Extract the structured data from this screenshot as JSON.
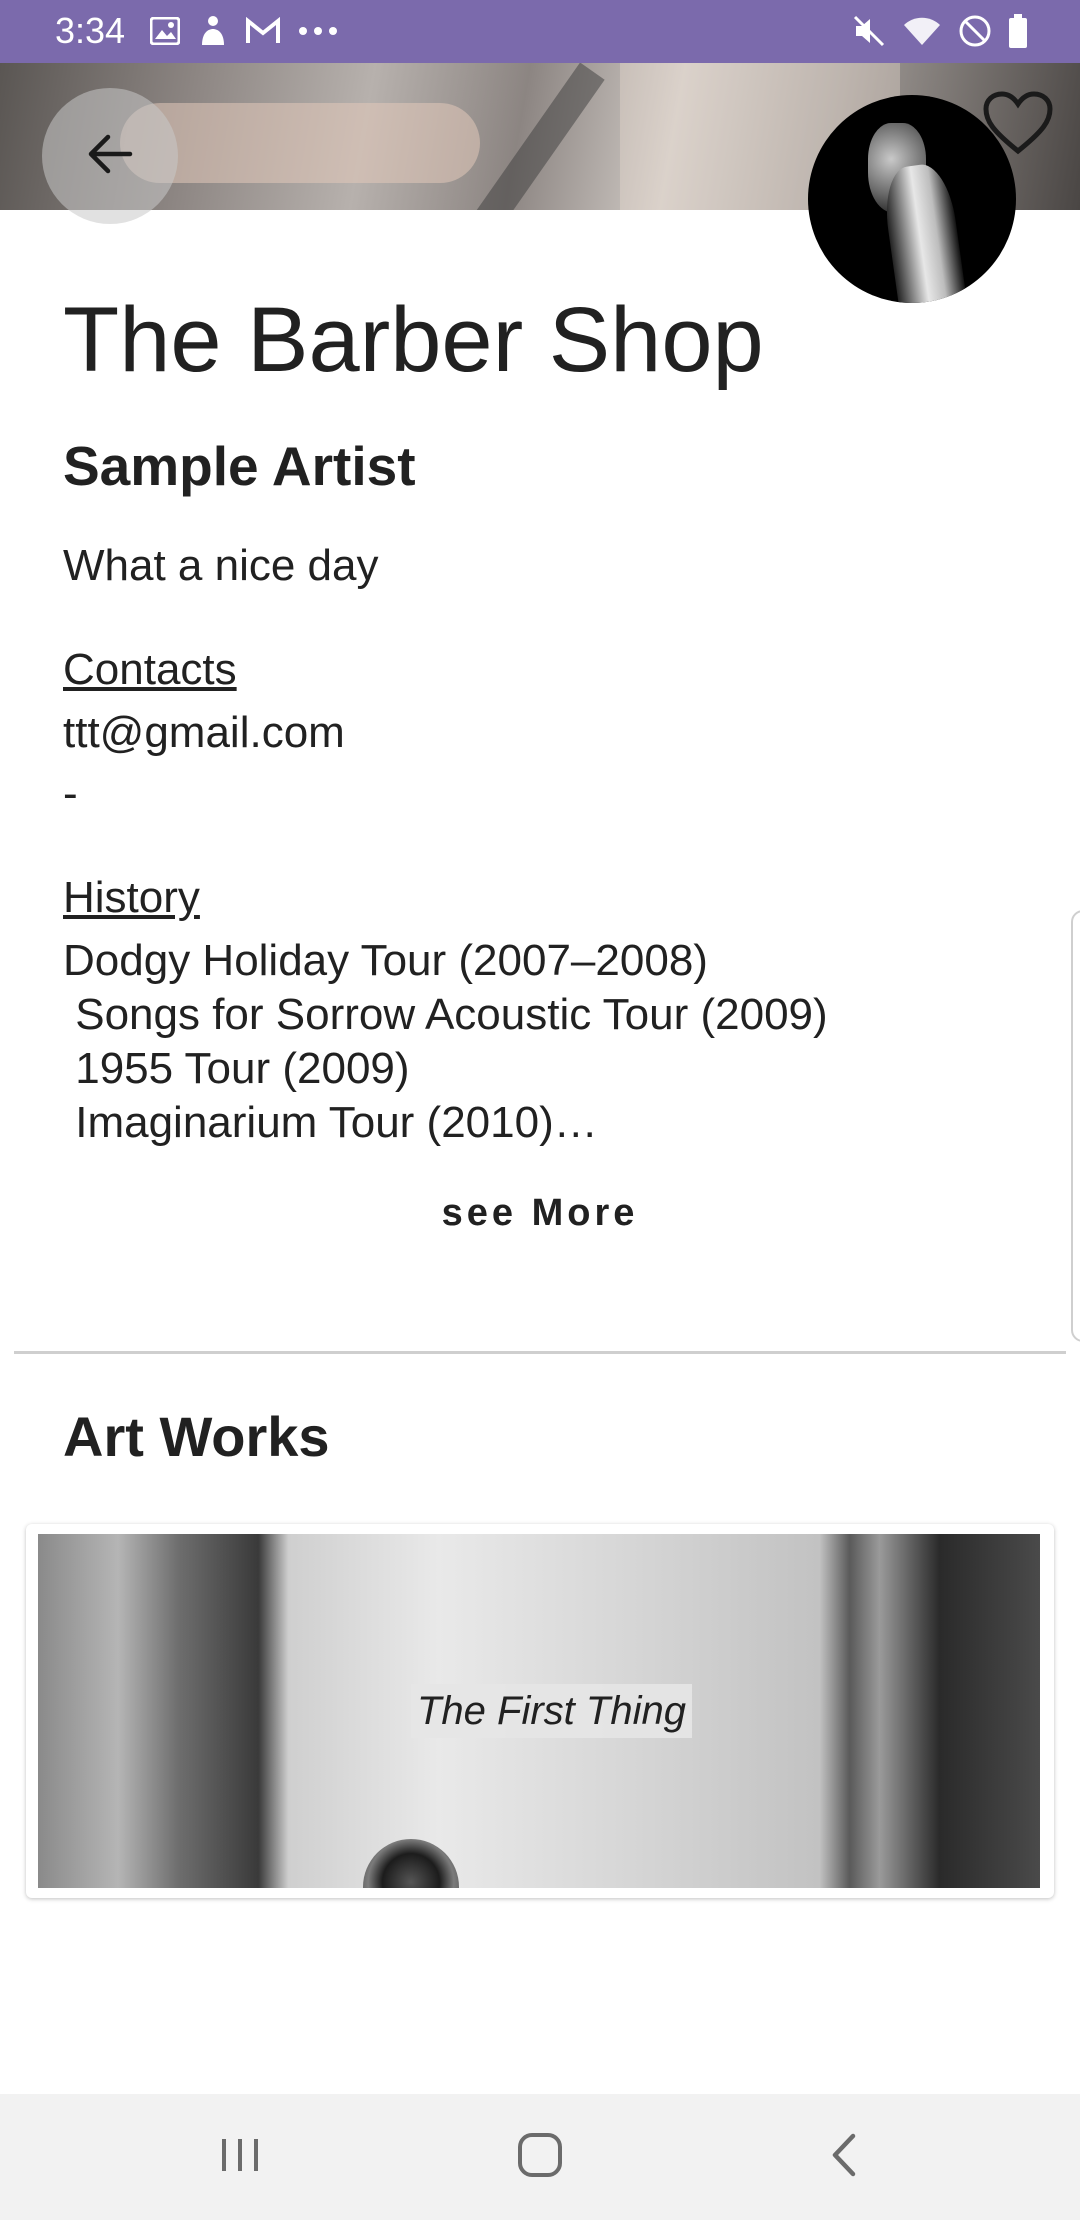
{
  "status_bar": {
    "time": "3:34",
    "left_icons": [
      "image-icon",
      "activity-icon",
      "gmail-icon",
      "more-dots-icon"
    ],
    "right_icons": [
      "mute-icon",
      "wifi-icon",
      "do-not-disturb-icon",
      "battery-icon"
    ],
    "background": "#7B6AAC"
  },
  "header": {
    "back_icon": "arrow-back-icon",
    "favorite_icon": "heart-outline-icon"
  },
  "title": "The Barber Shop",
  "artist": "Sample Artist",
  "tagline": "What a nice day",
  "contacts": {
    "label": "Contacts",
    "email": "ttt@gmail.com",
    "phone": "-"
  },
  "history": {
    "label": "History",
    "text": "Dodgy Holiday Tour (2007–2008)\n Songs for Sorrow Acoustic Tour (2009)\n 1955 Tour (2009)\n Imaginarium Tour (2010)…"
  },
  "see_more": "see More",
  "art_works": {
    "heading": "Art Works",
    "items": [
      {
        "caption": "The First Thing"
      }
    ]
  },
  "nav_bar": {
    "recents_icon": "recents-icon",
    "home_icon": "home-icon",
    "back_icon": "nav-back-icon"
  }
}
